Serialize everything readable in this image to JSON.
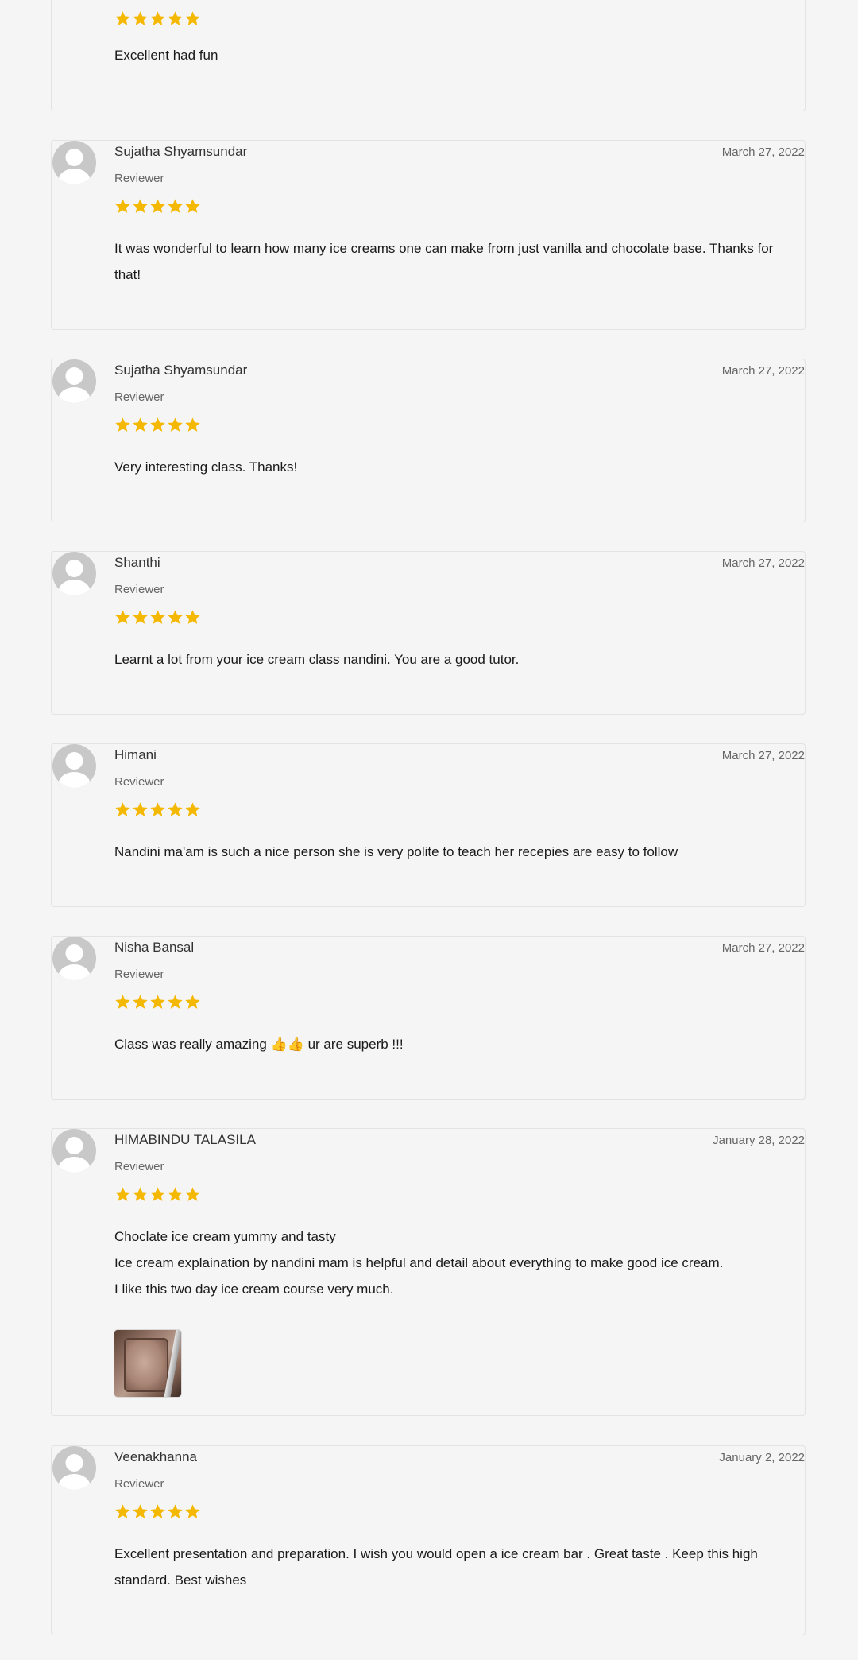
{
  "colors": {
    "background": "#f5f5f5",
    "star": "#f5b800",
    "card_border": "#e3e3e3",
    "avatar": "#c8c8c8"
  },
  "reviews": [
    {
      "name": "",
      "role": "",
      "date": "",
      "rating": 5,
      "lines": [
        "Excellent had fun"
      ]
    },
    {
      "name": "Sujatha Shyamsundar",
      "role": "Reviewer",
      "date": "March 27, 2022",
      "rating": 5,
      "lines": [
        "It was wonderful to learn how many ice creams one can make from just vanilla and chocolate base. Thanks for that!"
      ]
    },
    {
      "name": "Sujatha Shyamsundar",
      "role": "Reviewer",
      "date": "March 27, 2022",
      "rating": 5,
      "lines": [
        "Very interesting class. Thanks!"
      ]
    },
    {
      "name": "Shanthi",
      "role": "Reviewer",
      "date": "March 27, 2022",
      "rating": 5,
      "lines": [
        "Learnt a lot from your ice cream class nandini. You are a good tutor."
      ]
    },
    {
      "name": "Himani",
      "role": "Reviewer",
      "date": "March 27, 2022",
      "rating": 5,
      "lines": [
        "Nandini ma'am is such a nice person she is very polite to teach her recepies are easy to follow"
      ]
    },
    {
      "name": "Nisha Bansal",
      "role": "Reviewer",
      "date": "March 27, 2022",
      "rating": 5,
      "lines": [
        "Class was really amazing 👍👍 ur are superb !!!"
      ]
    },
    {
      "name": "HIMABINDU TALASILA",
      "role": "Reviewer",
      "date": "January 28, 2022",
      "rating": 5,
      "lines": [
        "Choclate ice cream yummy and tasty",
        "Ice cream explaination by nandini mam is helpful and detail about everything to make good ice cream.",
        "I like this two day ice cream course very much."
      ],
      "has_photo": true
    },
    {
      "name": "Veenakhanna",
      "role": "Reviewer",
      "date": "January 2, 2022",
      "rating": 5,
      "lines": [
        "Excellent presentation and preparation. I wish you would open a ice cream bar . Great taste . Keep this high standard. Best wishes"
      ]
    }
  ]
}
